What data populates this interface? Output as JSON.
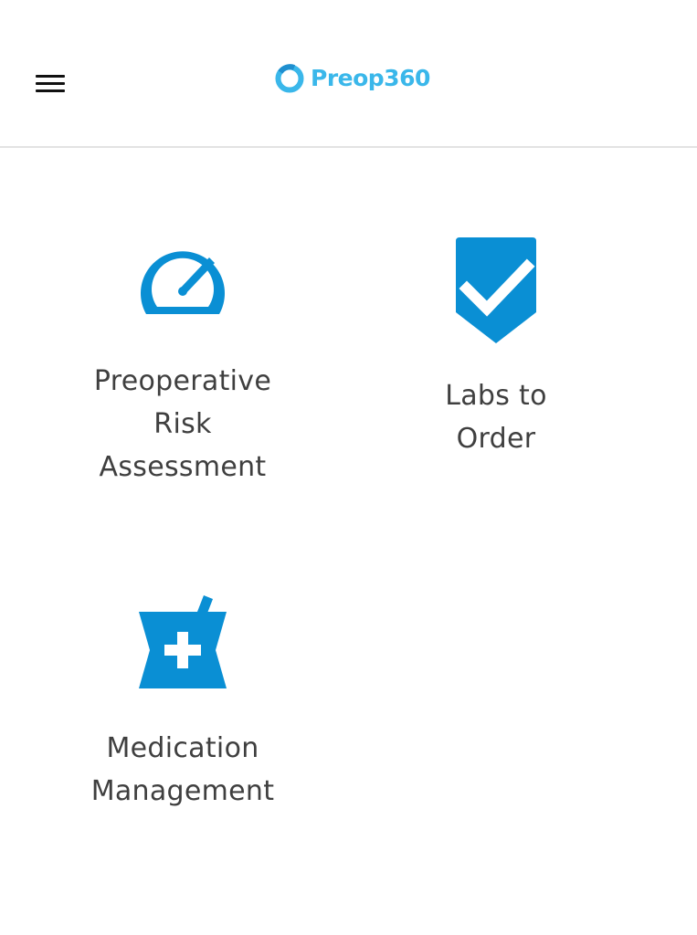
{
  "header": {
    "menu_icon": "hamburger-menu-icon",
    "logo_text": "Preop360",
    "logo_icon": "ring-logo-icon",
    "accent_color": "#3ab7ea"
  },
  "tiles": [
    {
      "icon": "speedometer-gauge-icon",
      "label_lines": [
        "Preoperative",
        "Risk",
        "Assessment"
      ]
    },
    {
      "icon": "shield-checkmark-icon",
      "label_lines": [
        "Labs to",
        "Order"
      ]
    },
    {
      "icon": "mortar-pestle-plus-icon",
      "label_lines": [
        "Medication",
        "Management"
      ]
    }
  ],
  "colors": {
    "icon_blue": "#0a8fd4",
    "label_gray": "#3f3f3f",
    "divider": "#e3e3e3"
  }
}
